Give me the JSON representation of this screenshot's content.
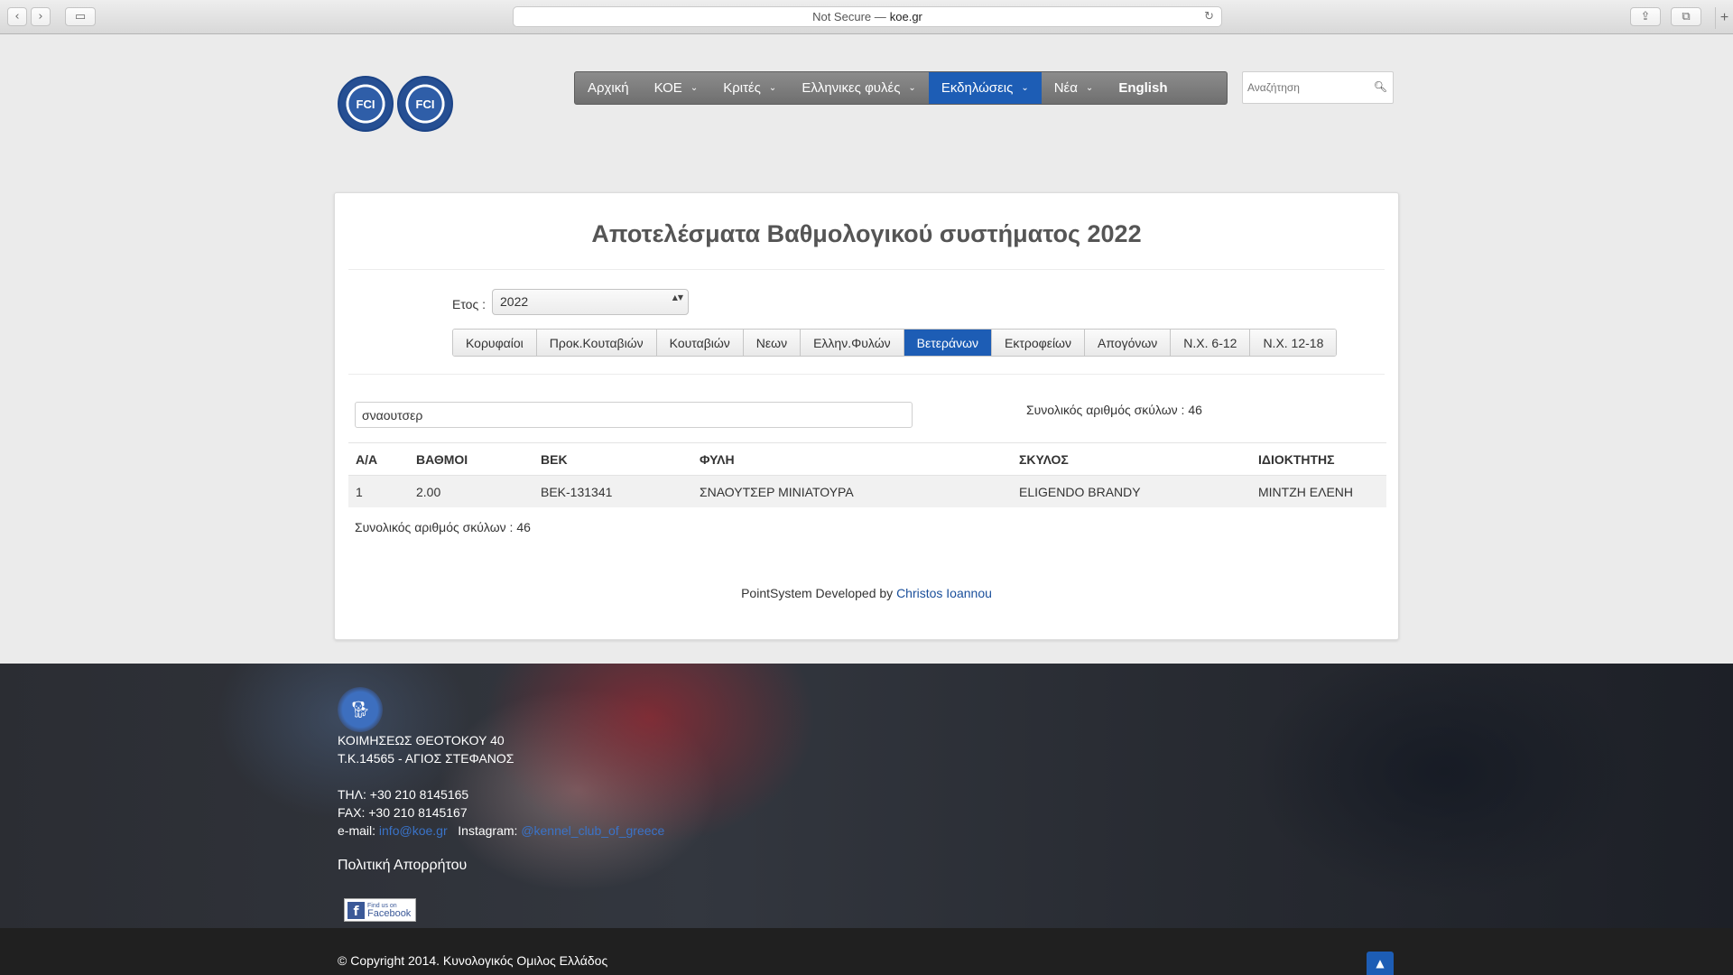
{
  "browser": {
    "url_prefix": "Not Secure —",
    "url_domain": "koe.gr",
    "back_glyph": "‹",
    "forward_glyph": "›",
    "sidebar_glyph": "▭",
    "reload_glyph": "↻",
    "share_glyph": "⇪",
    "tabs_glyph": "⧉",
    "new_tab_glyph": "+"
  },
  "logos": [
    "FCI",
    "FCI"
  ],
  "nav": {
    "items": [
      {
        "label": "Αρχική",
        "dropdown": false
      },
      {
        "label": "ΚΟΕ",
        "dropdown": true
      },
      {
        "label": "Κριτές",
        "dropdown": true
      },
      {
        "label": "Ελληνικες φυλές",
        "dropdown": true
      },
      {
        "label": "Εκδηλώσεις",
        "dropdown": true,
        "active": true
      },
      {
        "label": "Νέα",
        "dropdown": true
      },
      {
        "label": "English",
        "dropdown": false,
        "bold": true
      }
    ],
    "chevron": "⌄",
    "search_placeholder": "Αναζήτηση",
    "search_icon": "🔍︎"
  },
  "main": {
    "title": "Αποτελέσματα Βαθμολογικού συστήματος 2022",
    "year_label": "Ετος :",
    "year_value": "2022",
    "select_arrows": "▲▼",
    "tabs": [
      {
        "label": "Κορυφαίοι"
      },
      {
        "label": "Προκ.Κουταβιών"
      },
      {
        "label": "Κουταβιών"
      },
      {
        "label": "Νεων"
      },
      {
        "label": "Ελλην.Φυλών"
      },
      {
        "label": "Βετεράνων",
        "active": true
      },
      {
        "label": "Εκτροφείων"
      },
      {
        "label": "Απογόνων"
      },
      {
        "label": "Ν.Χ. 6-12"
      },
      {
        "label": "Ν.Χ. 12-18"
      }
    ],
    "filter_value": "σναουτσερ",
    "total_top": "Συνολικός αριθμός σκύλων : 46",
    "table": {
      "headers": [
        "Α/Α",
        "ΒΑΘΜΟΙ",
        "ΒΕΚ",
        "ΦΥΛΗ",
        "ΣΚΥΛΟΣ",
        "ΙΔΙΟΚΤΗΤΗΣ"
      ],
      "rows": [
        [
          "1",
          "2.00",
          "ΒΕΚ-131341",
          "ΣΝΑΟΥΤΣΕΡ ΜΙΝΙΑΤΟΥΡΑ",
          "ELIGENDO BRANDY",
          "ΜΙΝΤΖΗ ΕΛΕΝΗ"
        ]
      ]
    },
    "total_bottom": "Συνολικός αριθμός σκύλων : 46",
    "credit_prefix": "PointSystem Developed by",
    "credit_link": "Christos Ioannou"
  },
  "footer": {
    "address1": "ΚΟΙΜΗΣΕΩΣ ΘΕΟΤΟΚΟΥ 40",
    "address2": "Τ.Κ.14565 - ΑΓΙΟΣ ΣΤΕΦΑΝΟΣ",
    "phone": "ΤΗΛ: +30 210 8145165",
    "fax": "FAX: +30 210 8145167",
    "email_label": "e-mail:",
    "email_value": "info@koe.gr",
    "instagram_label": "Instagram:",
    "instagram_value": "@kennel_club_of_greece",
    "policy": "Πολιτική Απορρήτου",
    "fb_small": "Find us on",
    "fb_big": "Facebook",
    "fb_letter": "f",
    "copyright": "© Copyright 2014. Κυνολογικός Ομιλος Ελλάδος",
    "top_glyph": "▲"
  }
}
